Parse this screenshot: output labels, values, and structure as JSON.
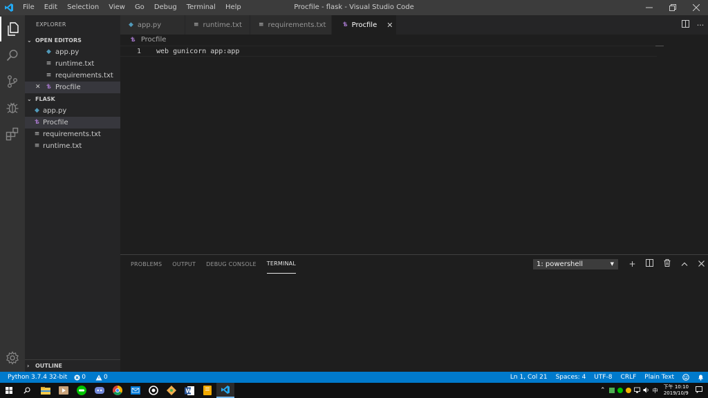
{
  "titlebar": {
    "menu": [
      "File",
      "Edit",
      "Selection",
      "View",
      "Go",
      "Debug",
      "Terminal",
      "Help"
    ],
    "window_title": "Procfile - flask - Visual Studio Code",
    "minimize": "—",
    "maximize": "❐",
    "close": "✕"
  },
  "sidebar": {
    "title": "EXPLORER",
    "open_editors": {
      "header": "OPEN EDITORS",
      "items": [
        {
          "label": "app.py",
          "icon": "python-file-icon"
        },
        {
          "label": "runtime.txt",
          "icon": "text-file-icon"
        },
        {
          "label": "requirements.txt",
          "icon": "text-file-icon"
        },
        {
          "label": "Procfile",
          "icon": "heroku-file-icon"
        }
      ]
    },
    "folder": {
      "header": "FLASK",
      "items": [
        {
          "label": "app.py",
          "icon": "python-file-icon"
        },
        {
          "label": "Procfile",
          "icon": "heroku-file-icon"
        },
        {
          "label": "requirements.txt",
          "icon": "text-file-icon"
        },
        {
          "label": "runtime.txt",
          "icon": "text-file-icon"
        }
      ]
    },
    "outline": "OUTLINE"
  },
  "tabs": [
    {
      "label": "app.py",
      "icon": "python-file-icon"
    },
    {
      "label": "runtime.txt",
      "icon": "text-file-icon"
    },
    {
      "label": "requirements.txt",
      "icon": "text-file-icon"
    },
    {
      "label": "Procfile",
      "icon": "heroku-file-icon",
      "active": true
    }
  ],
  "breadcrumb": "Procfile",
  "editor": {
    "lines": [
      {
        "number": "1",
        "text": "web gunicorn app:app"
      }
    ]
  },
  "panel": {
    "tabs": [
      "PROBLEMS",
      "OUTPUT",
      "DEBUG CONSOLE",
      "TERMINAL"
    ],
    "terminal_select": "1: powershell"
  },
  "statusbar": {
    "python": "Python 3.7.4 32-bit",
    "errors": "0",
    "warnings": "0",
    "position": "Ln 1, Col 21",
    "spaces": "Spaces: 4",
    "encoding": "UTF-8",
    "eol": "CRLF",
    "language": "Plain Text"
  },
  "taskbar": {
    "clock_period": "下午",
    "clock_time": "10:10",
    "clock_date": "2019/10/9",
    "ime": "中"
  },
  "colors": {
    "accent": "#007acc",
    "python_icon": "#519aba",
    "heroku_icon": "#a074c4"
  }
}
